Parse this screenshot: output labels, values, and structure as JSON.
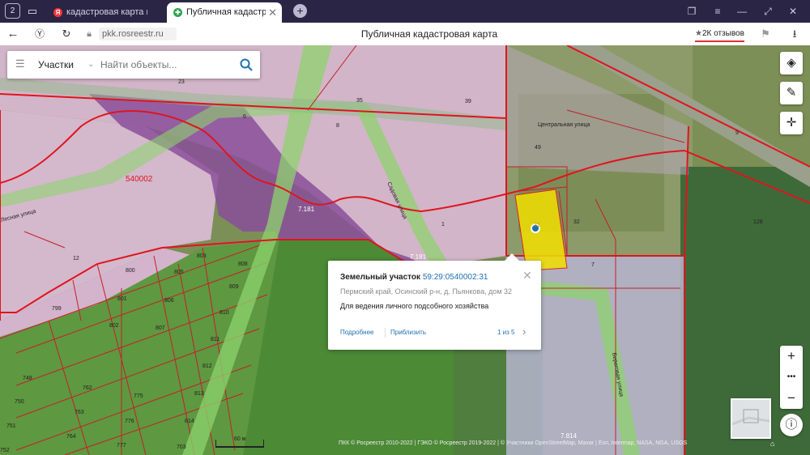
{
  "browser": {
    "tabs": [
      {
        "title": "кадастровая карта перм",
        "favicon": "Я",
        "active": false
      },
      {
        "title": "Публичная кадастрова",
        "favicon": "✚",
        "active": true
      }
    ],
    "url": "pkk.rosreestr.ru",
    "page_title": "Публичная кадастровая карта",
    "reviews": "2К отзывов"
  },
  "search": {
    "type_label": "Участки",
    "placeholder": "Найти объекты..."
  },
  "popup": {
    "type": "Земельный участок",
    "cadastral_number": "59:29:0540002:31",
    "address": "Пермский край, Осинский р-н, д. Пьянкова, дом 32",
    "usage": "Для ведения личного подсобного хозяйства",
    "more_link": "Подробнее",
    "zoom_link": "Приблизить",
    "pagination": "1 из 5"
  },
  "map": {
    "scale_label": "60 м",
    "attribution": "ПКК © Росреестр 2010-2022 | ГЭКО © Росреестр 2019-2022 | © Участники OpenStreetMap, Maxar | Esri, Intermap, NASA, NGA, USGS",
    "street_labels": [
      "Центральная улица",
      "Лесная улица",
      "Садовая улица",
      "Береговая улица"
    ],
    "zone_labels": [
      "540002",
      "7.181",
      "7.181",
      "7.814"
    ],
    "parcel_labels": [
      "23",
      "35",
      "39",
      "6",
      "8",
      "9",
      "49",
      "1",
      "32",
      "31",
      "7",
      "128",
      "12",
      "800",
      "805",
      "803",
      "808",
      "809",
      "810",
      "811",
      "812",
      "813",
      "814",
      "801",
      "806",
      "807",
      "802",
      "799",
      "748",
      "750",
      "751",
      "752",
      "762",
      "763",
      "764",
      "775",
      "776",
      "777",
      "703"
    ]
  },
  "colors": {
    "boundary": "#e0141e",
    "parcel_line": "#c4202a",
    "selected_parcel": "#f2e000",
    "link": "#1f6fb2",
    "green_strip": "#8ed36e",
    "purple_zone": "#8a4f9a"
  },
  "icons": [
    "layers-icon",
    "ruler-icon",
    "locate-icon",
    "zoom-in-icon",
    "zoom-menu-icon",
    "zoom-out-icon",
    "info-icon",
    "search-icon",
    "menu-icon",
    "close-icon",
    "chevron-right-icon",
    "map-marker-icon"
  ]
}
